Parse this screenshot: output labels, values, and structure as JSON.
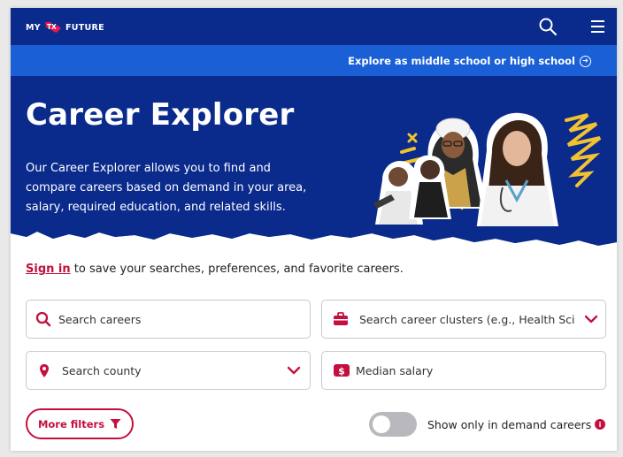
{
  "nav": {
    "logo_left": "MY",
    "logo_flag": "TX",
    "logo_right": "FUTURE",
    "search_icon": "search-icon",
    "menu_icon": "hamburger-menu-icon"
  },
  "subbar": {
    "explore_label": "Explore as middle school or high school",
    "explore_icon": "arrow-circle-right-icon"
  },
  "hero": {
    "title": "Career Explorer",
    "description": "Our Career Explorer allows you to find and compare careers based on demand in your area, salary, required education, and related skills."
  },
  "signin": {
    "link": "Sign in",
    "rest": " to save your searches, preferences, and favorite careers."
  },
  "filters": {
    "search_careers_placeholder": "Search careers",
    "search_clusters_placeholder": "Search career clusters (e.g., Health Science)",
    "search_county_placeholder": "Search county",
    "median_salary_placeholder": "Median salary",
    "more_filters_label": "More filters",
    "in_demand_label": "Show only in demand careers",
    "in_demand_on": false
  },
  "colors": {
    "navy": "#0a2a8c",
    "blue": "#1a5fd6",
    "accent_red": "#c4103e",
    "yellow": "#f2c230"
  }
}
